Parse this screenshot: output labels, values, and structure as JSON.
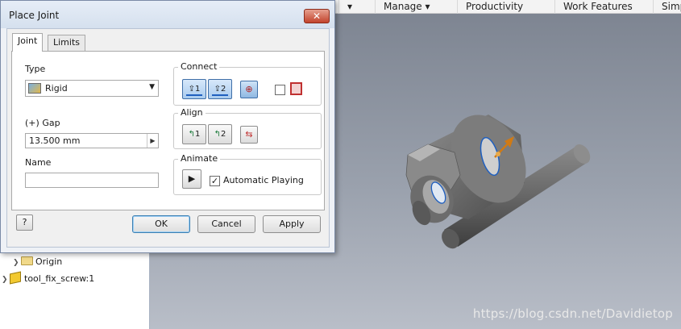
{
  "ribbon": {
    "tabs": [
      "Manage",
      "Productivity",
      "Work Features",
      "Simp"
    ]
  },
  "browser": {
    "items": [
      {
        "label": "Origin"
      },
      {
        "label": "tool_fix_screw:1"
      }
    ]
  },
  "dialog": {
    "title": "Place Joint",
    "close_label": "✕",
    "tabs": [
      "Joint",
      "Limits"
    ],
    "type_label": "Type",
    "type_value": "Rigid",
    "gap_label": "Gap",
    "gap_value": "13.500 mm",
    "name_label": "Name",
    "name_value": "",
    "connect_label": "Connect",
    "connect_btn1": "1",
    "connect_btn2": "2",
    "align_label": "Align",
    "align_btn1": "1",
    "align_btn2": "2",
    "animate_label": "Animate",
    "automatic_playing_label": "Automatic Playing",
    "automatic_playing_checked": true,
    "ok_label": "OK",
    "cancel_label": "Cancel",
    "apply_label": "Apply",
    "help_icon": "?"
  },
  "viewport": {
    "watermark": "https://blog.csdn.net/Davidietop"
  },
  "colors": {
    "viewport_top": "#7e8592",
    "viewport_bottom": "#b9bec8",
    "selection_blue": "#1f5fbf",
    "arrow_orange": "#d07a14"
  }
}
